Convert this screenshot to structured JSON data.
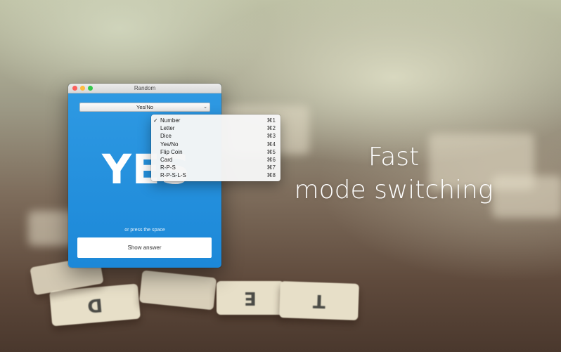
{
  "window": {
    "title": "Random",
    "mode_select": {
      "value": "Yes/No",
      "chevron": "⌄"
    },
    "answer": "YES",
    "hint": "or press the space",
    "show_answer_label": "Show answer"
  },
  "menu": {
    "items": [
      {
        "label": "Number",
        "shortcut": "⌘1",
        "check": "✓"
      },
      {
        "label": "Letter",
        "shortcut": "⌘2",
        "check": ""
      },
      {
        "label": "Dice",
        "shortcut": "⌘3",
        "check": ""
      },
      {
        "label": "Yes/No",
        "shortcut": "⌘4",
        "check": ""
      },
      {
        "label": "Flip Coin",
        "shortcut": "⌘5",
        "check": ""
      },
      {
        "label": "Card",
        "shortcut": "⌘6",
        "check": ""
      },
      {
        "label": "R-P-S",
        "shortcut": "⌘7",
        "check": ""
      },
      {
        "label": "R-P-S-L-S",
        "shortcut": "⌘8",
        "check": ""
      }
    ]
  },
  "headline": {
    "line1": "Fast",
    "line2": "mode switching"
  },
  "tiles": [
    "D",
    "E",
    "T"
  ],
  "colors": {
    "window_blue": "#2f9ae3",
    "text_white": "#ffffff"
  }
}
